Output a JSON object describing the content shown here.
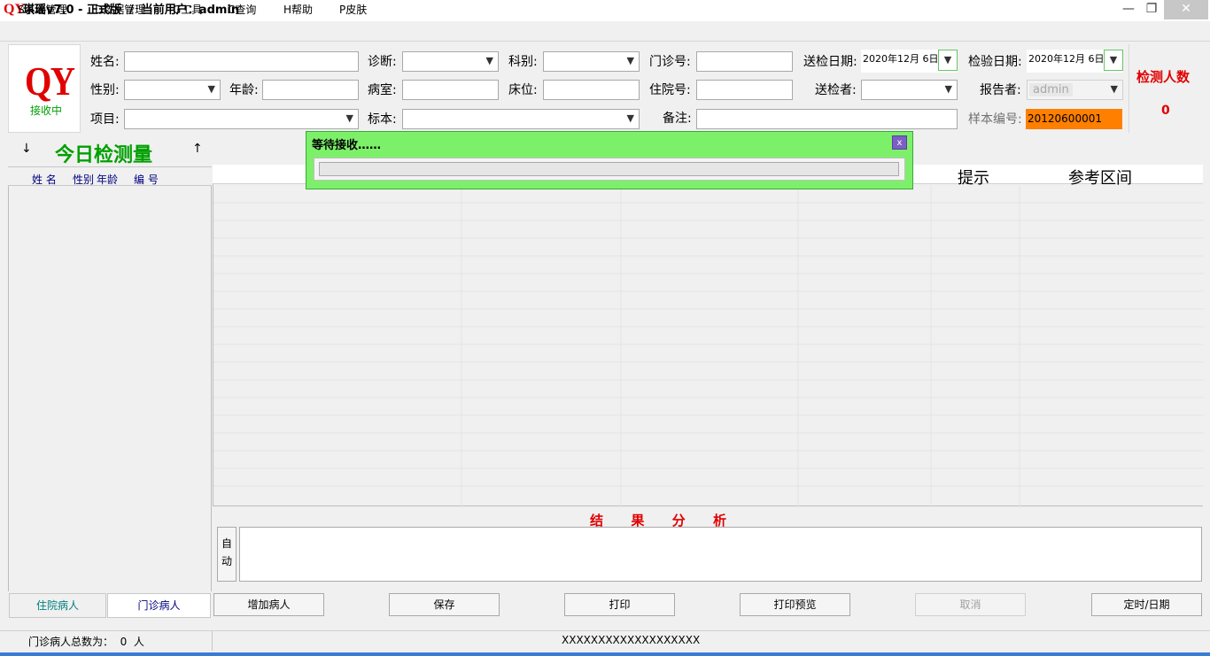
{
  "window": {
    "logo": "QY",
    "title": "琪瑶v7.0 - 正式版  /  当前用户：admin",
    "minimize_icon": "minimize-icon",
    "restore_icon": "restore-icon",
    "close_icon": "close-icon"
  },
  "menu": {
    "items": [
      "S系统管理",
      "D数据管理",
      "G工具",
      "C查询",
      "H帮助",
      "P皮肤"
    ]
  },
  "logo_panel": {
    "mark": "QY",
    "status": "接收中",
    "status_color": "#00a000"
  },
  "form": {
    "name_label": "姓名:",
    "gender_label": "性别:",
    "age_label": "年龄:",
    "item_label": "项目:",
    "diagnosis_label": "诊断:",
    "ward_label": "病室:",
    "specimen_label": "标本:",
    "department_label": "科别:",
    "bed_label": "床位:",
    "outpatient_label": "门诊号:",
    "inpatient_label": "住院号:",
    "remark_label": "备注:",
    "send_date_label": "送检日期:",
    "send_date_value": "2020年12月 6日",
    "sender_label": "送检者:",
    "test_date_label": "检验日期:",
    "test_date_value": "2020年12月 6日",
    "reporter_label": "报告者:",
    "reporter_value": "admin",
    "sample_no_label": "样本编号:",
    "sample_no_value": "20120600001",
    "sample_no_bg": "#ff7f00"
  },
  "counter": {
    "title": "检测人数",
    "value": "0",
    "color": "#e00000"
  },
  "left_panel": {
    "down_arrow": "↓",
    "title": "今日检测量",
    "up_arrow": "↑",
    "col_name": "姓  名",
    "col_gender": "性别",
    "col_age": "年龄",
    "col_no": "编  号",
    "tab_inpatient": "住院病人",
    "tab_outpatient": "门诊病人"
  },
  "grid": {
    "col_hint": "提示",
    "col_range": "参考区间"
  },
  "analysis": {
    "title": "结      果      分      析",
    "auto_button": "自动"
  },
  "buttons": {
    "add_patient": "增加病人",
    "save": "保存",
    "print": "打印",
    "print_preview": "打印预览",
    "cancel": "取消",
    "timer_date": "定时/日期"
  },
  "status": {
    "outpatient_total": "门诊病人总数为：  0  人",
    "center": "XXXXXXXXXXXXXXXXXXX"
  },
  "dialog": {
    "title": "等待接收……",
    "close": "x",
    "progress": 0
  }
}
